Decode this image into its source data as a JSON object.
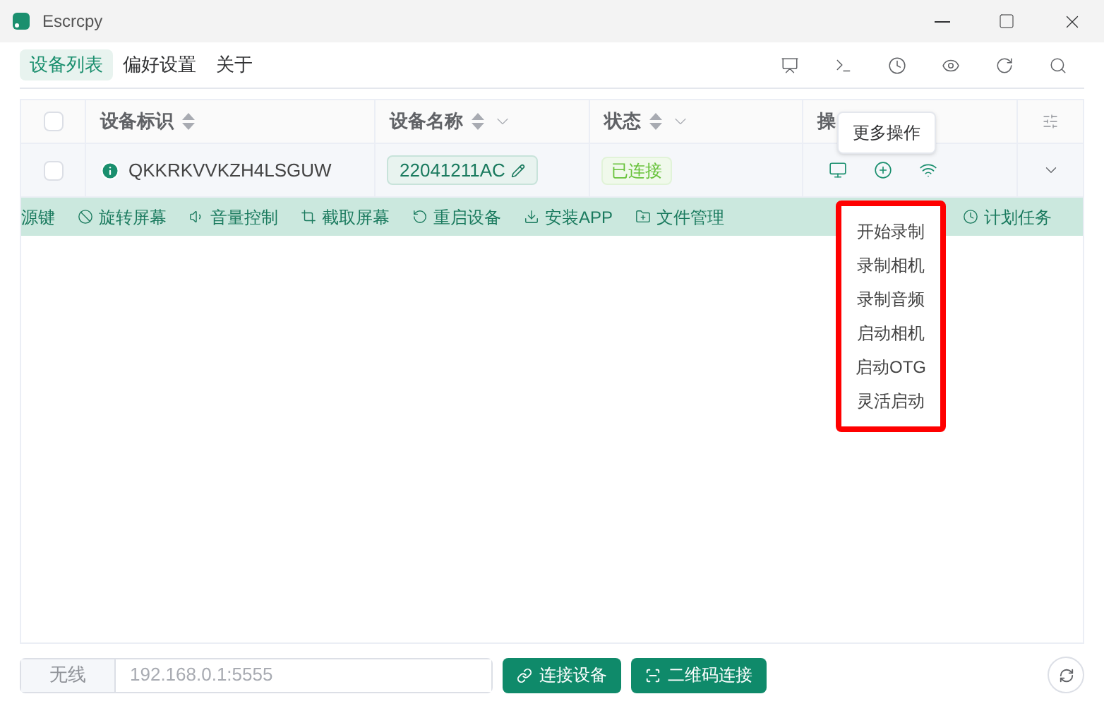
{
  "window": {
    "title": "Escrcpy"
  },
  "tabs": [
    {
      "label": "设备列表",
      "selected": true
    },
    {
      "label": "偏好设置",
      "selected": false
    },
    {
      "label": "关于",
      "selected": false
    }
  ],
  "table": {
    "select_all": {
      "checked": false
    },
    "columns": [
      {
        "label": "设备标识",
        "sortable": true,
        "filterable": false
      },
      {
        "label": "设备名称",
        "sortable": true,
        "filterable": true
      },
      {
        "label": "状态",
        "sortable": true,
        "filterable": true
      },
      {
        "label": "操"
      }
    ],
    "rows": [
      {
        "checked": false,
        "id": "QKKRKVVKZH4LSGUW",
        "name": "22041211AC",
        "status": "已连接",
        "expanded": false
      }
    ]
  },
  "action_bar": [
    "源键",
    "旋转屏幕",
    "音量控制",
    "截取屏幕",
    "重启设备",
    "安装APP",
    "文件管理",
    "计划任务"
  ],
  "tooltip": "更多操作",
  "menu": [
    "开始录制",
    "录制相机",
    "录制音频",
    "启动相机",
    "启动OTG",
    "灵活启动"
  ],
  "footer": {
    "prefix": "无线",
    "address": "192.168.0.1:5555",
    "buttons": [
      "连接设备",
      "二维码连接"
    ]
  }
}
